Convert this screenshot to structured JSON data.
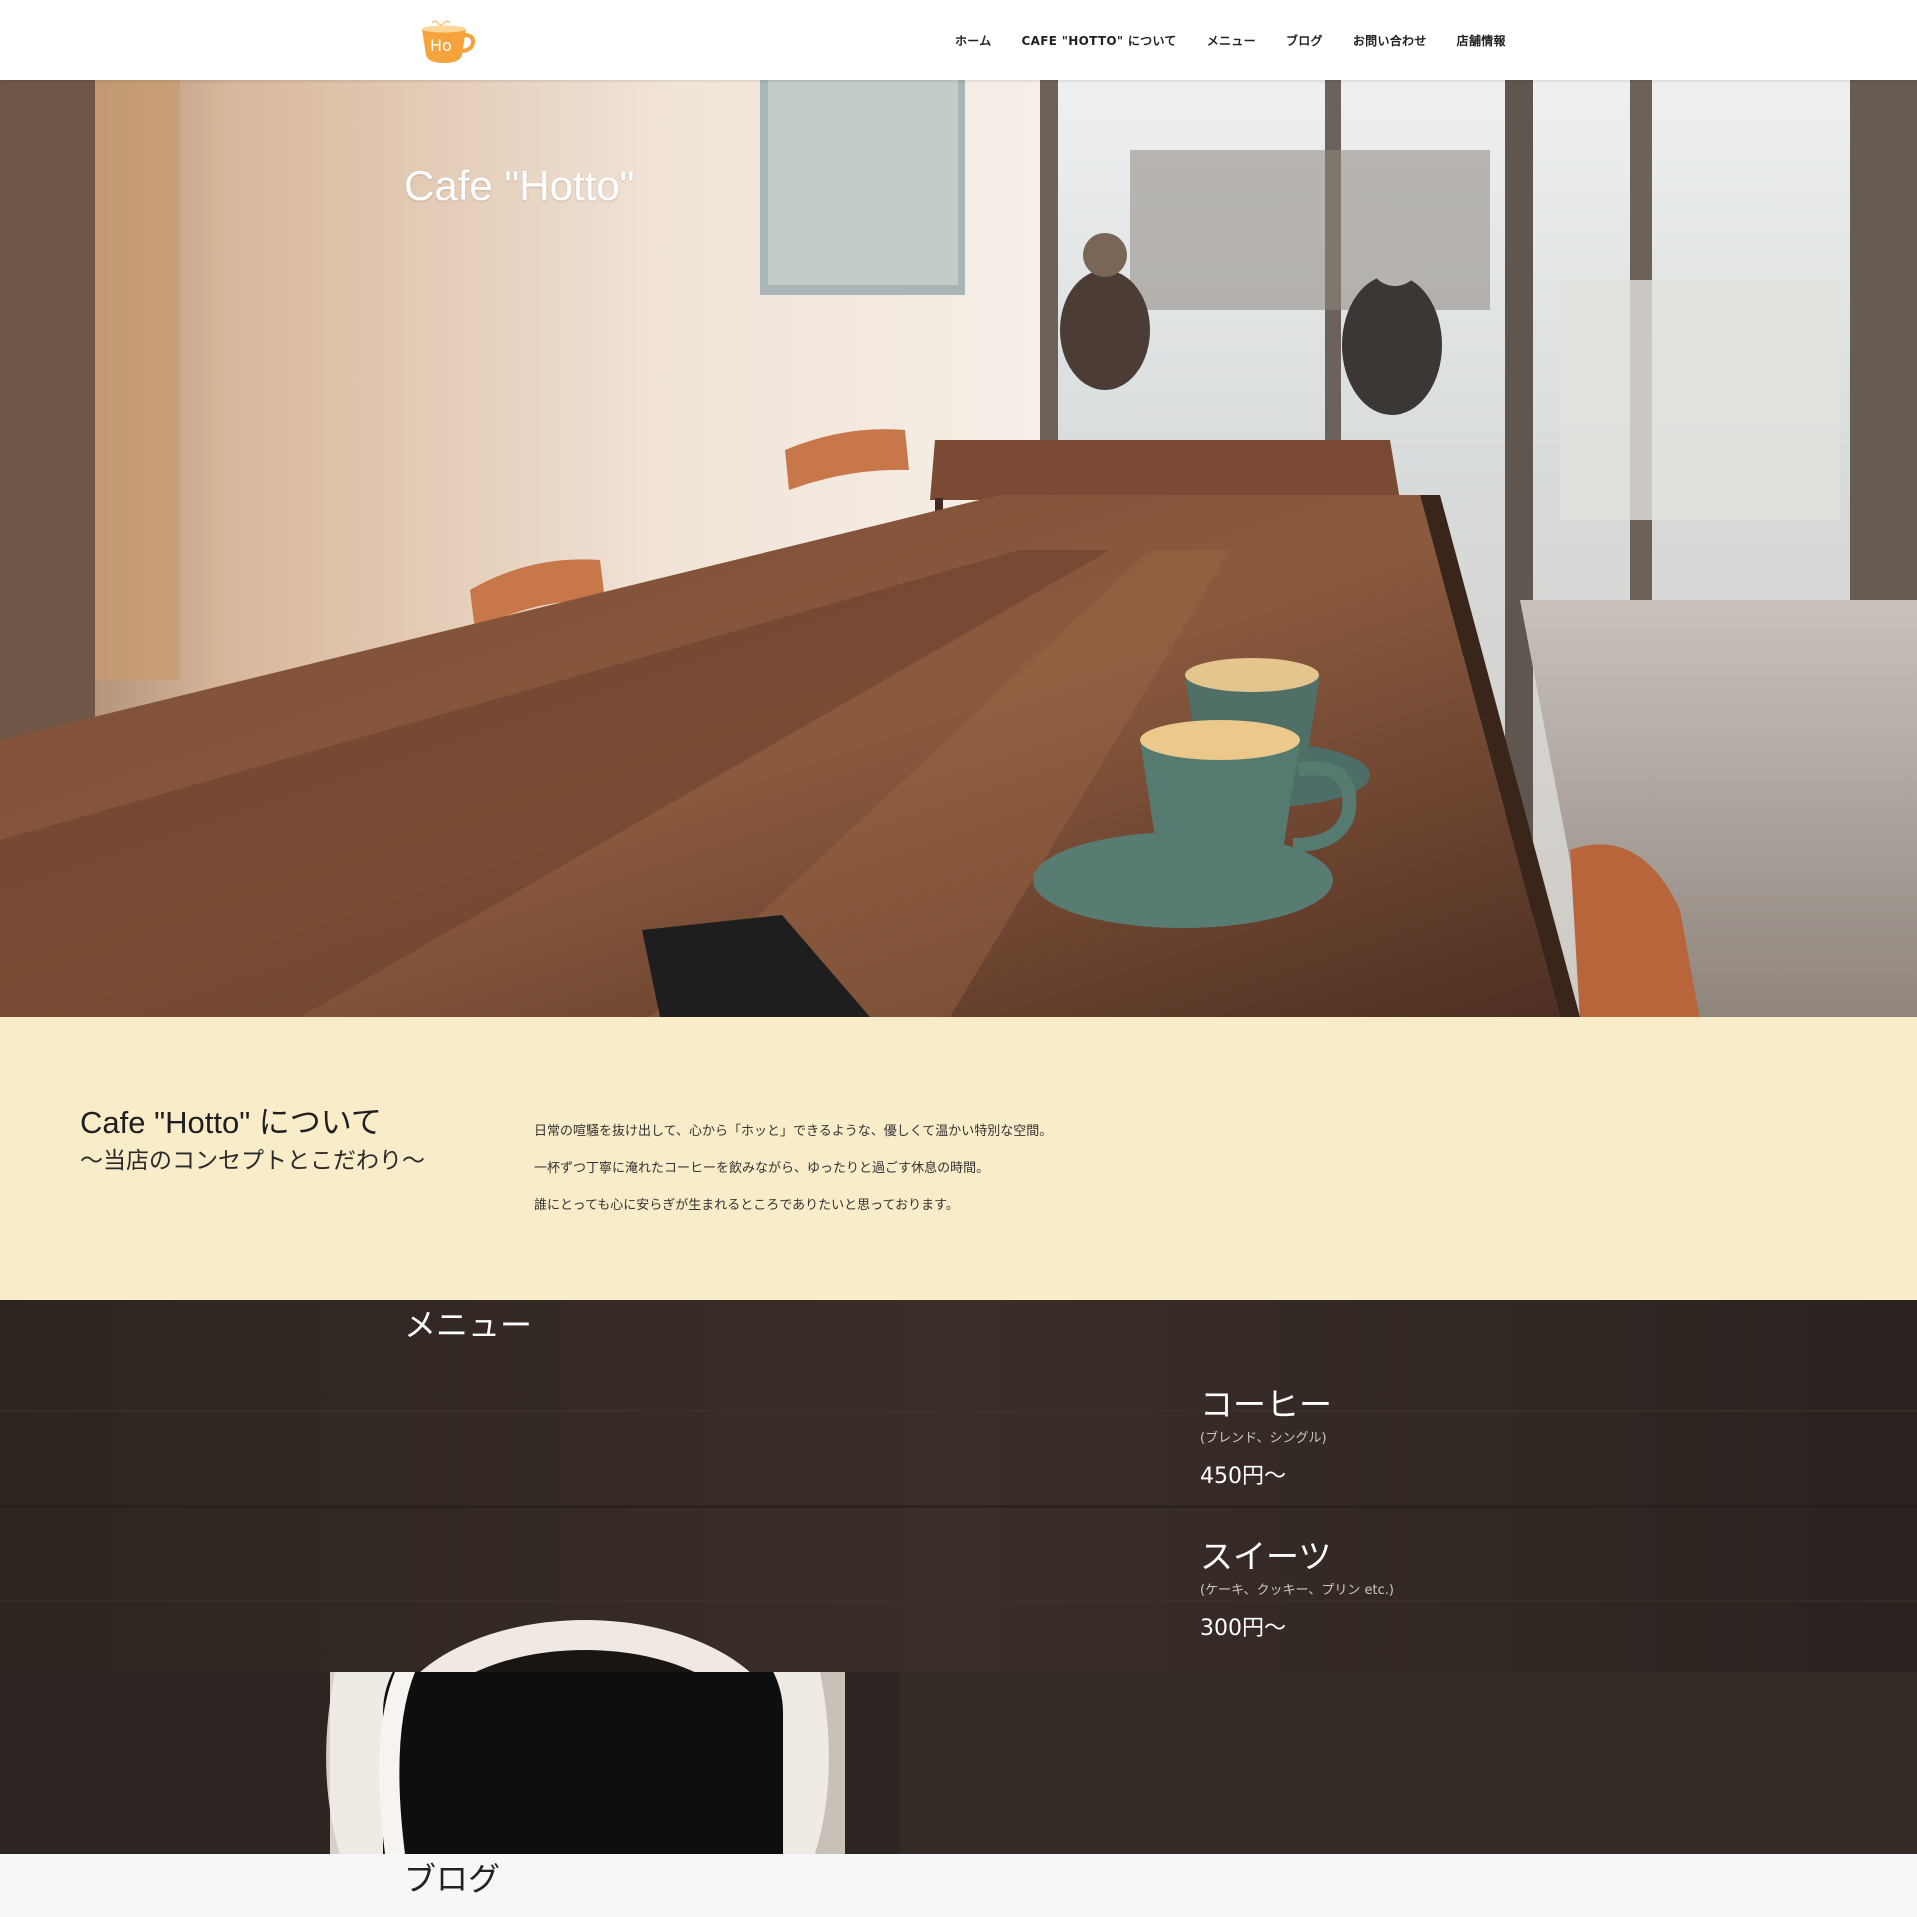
{
  "header": {
    "logo_text": "Ho",
    "nav": [
      {
        "label": "ホーム"
      },
      {
        "label": "CAFE \"HOTTO\" について"
      },
      {
        "label": "メニュー"
      },
      {
        "label": "ブログ"
      },
      {
        "label": "お問い合わせ"
      },
      {
        "label": "店舗情報"
      }
    ]
  },
  "hero": {
    "title": "Cafe \"Hotto\""
  },
  "about": {
    "heading": "Cafe \"Hotto\" について",
    "subheading": "～当店のコンセプトとこだわり～",
    "paragraphs": [
      "日常の喧騒を抜け出して、心から「ホッと」できるような、優しくて温かい特別な空間。",
      "一杯ずつ丁寧に淹れたコーヒーを飲みながら、ゆったりと過ごす休息の時間。",
      "誰にとっても心に安らぎが生まれるところでありたいと思っております。"
    ]
  },
  "menu": {
    "title": "メニュー",
    "items": [
      {
        "name": "コーヒー",
        "desc": "(ブレンド、シングル)",
        "price": "450円～"
      },
      {
        "name": "スイーツ",
        "desc": "(ケーキ、クッキー、プリン etc.)",
        "price": "300円～"
      }
    ]
  },
  "blog": {
    "title": "ブログ"
  },
  "colors": {
    "logo_orange": "#f5a33c",
    "about_bg": "#f9ecc9",
    "menu_bg": "#332a25"
  }
}
